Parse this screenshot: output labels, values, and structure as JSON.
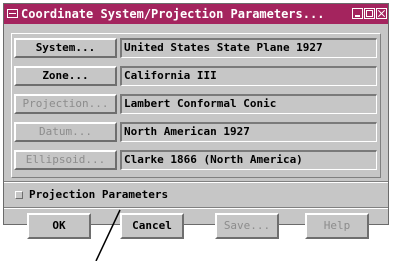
{
  "window": {
    "title": "Coordinate System/Projection Parameters...",
    "titlebar_color": "#a4245e"
  },
  "params": [
    {
      "button": "System...",
      "value": "United States State Plane 1927",
      "enabled": true
    },
    {
      "button": "Zone...",
      "value": "California III",
      "enabled": true
    },
    {
      "button": "Projection...",
      "value": "Lambert Conformal Conic",
      "enabled": false
    },
    {
      "button": "Datum...",
      "value": "North American 1927",
      "enabled": false
    },
    {
      "button": "Ellipsoid...",
      "value": "Clarke 1866 (North America)",
      "enabled": false
    }
  ],
  "projection_parameters": {
    "label": "Projection Parameters",
    "checked": false
  },
  "actions": {
    "ok": "OK",
    "cancel": "Cancel",
    "save": "Save...",
    "help": "Help"
  }
}
